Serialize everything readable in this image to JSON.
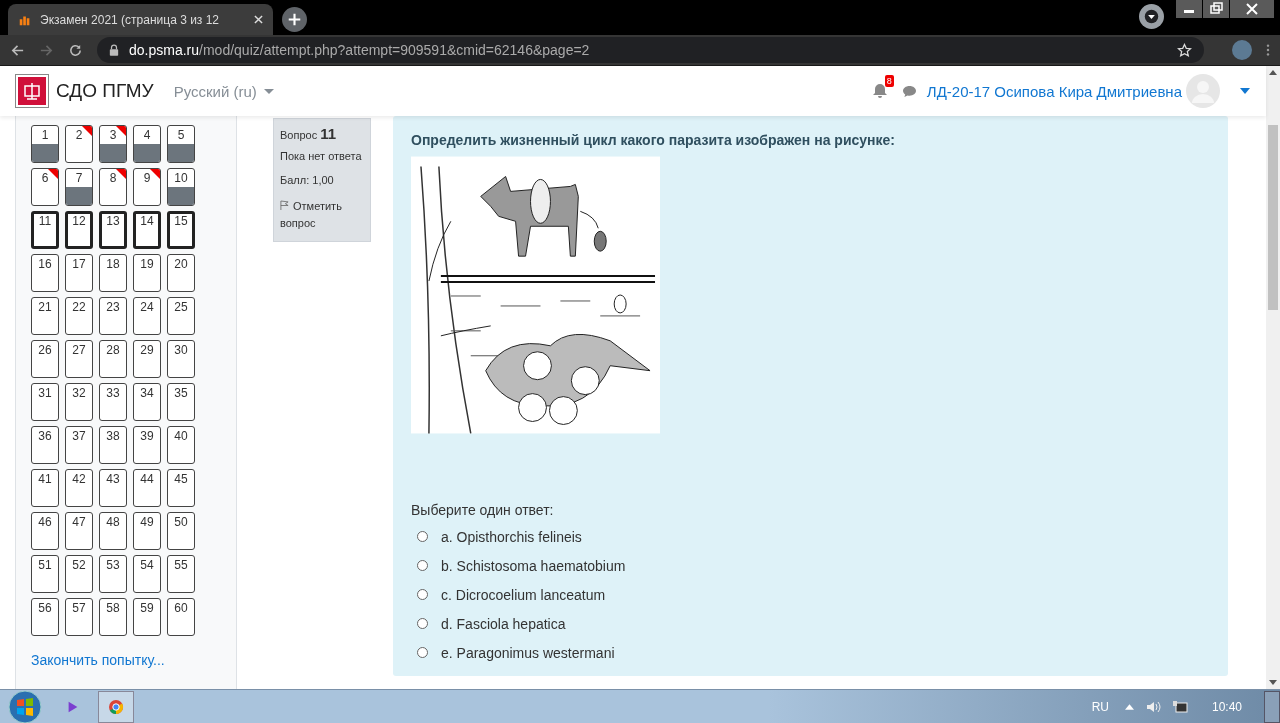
{
  "browser": {
    "tab_title": "Экзамен 2021 (страница 3 из 12",
    "url_host": "do.psma.ru",
    "url_path": "/mod/quiz/attempt.php?attempt=909591&cmid=62146&page=2"
  },
  "header": {
    "site_name": "СДО ПГМУ",
    "language": "Русский (ru)",
    "notification_count": "8",
    "user_name": "ЛД-20-17 Осипова Кира Дмитриевна"
  },
  "quiz_nav": {
    "items": [
      {
        "number": "1",
        "answered": true,
        "flagged": false,
        "current": false
      },
      {
        "number": "2",
        "answered": false,
        "flagged": true,
        "current": false
      },
      {
        "number": "3",
        "answered": true,
        "flagged": true,
        "current": false
      },
      {
        "number": "4",
        "answered": true,
        "flagged": false,
        "current": false
      },
      {
        "number": "5",
        "answered": true,
        "flagged": false,
        "current": false
      },
      {
        "number": "6",
        "answered": false,
        "flagged": true,
        "current": false
      },
      {
        "number": "7",
        "answered": true,
        "flagged": false,
        "current": false
      },
      {
        "number": "8",
        "answered": false,
        "flagged": true,
        "current": false
      },
      {
        "number": "9",
        "answered": false,
        "flagged": true,
        "current": false
      },
      {
        "number": "10",
        "answered": true,
        "flagged": false,
        "current": false
      },
      {
        "number": "11",
        "answered": false,
        "flagged": false,
        "current": true
      },
      {
        "number": "12",
        "answered": false,
        "flagged": false,
        "current": true
      },
      {
        "number": "13",
        "answered": false,
        "flagged": false,
        "current": true
      },
      {
        "number": "14",
        "answered": false,
        "flagged": false,
        "current": true
      },
      {
        "number": "15",
        "answered": false,
        "flagged": false,
        "current": true
      },
      {
        "number": "16",
        "answered": false,
        "flagged": false,
        "current": false
      },
      {
        "number": "17",
        "answered": false,
        "flagged": false,
        "current": false
      },
      {
        "number": "18",
        "answered": false,
        "flagged": false,
        "current": false
      },
      {
        "number": "19",
        "answered": false,
        "flagged": false,
        "current": false
      },
      {
        "number": "20",
        "answered": false,
        "flagged": false,
        "current": false
      },
      {
        "number": "21",
        "answered": false,
        "flagged": false,
        "current": false
      },
      {
        "number": "22",
        "answered": false,
        "flagged": false,
        "current": false
      },
      {
        "number": "23",
        "answered": false,
        "flagged": false,
        "current": false
      },
      {
        "number": "24",
        "answered": false,
        "flagged": false,
        "current": false
      },
      {
        "number": "25",
        "answered": false,
        "flagged": false,
        "current": false
      },
      {
        "number": "26",
        "answered": false,
        "flagged": false,
        "current": false
      },
      {
        "number": "27",
        "answered": false,
        "flagged": false,
        "current": false
      },
      {
        "number": "28",
        "answered": false,
        "flagged": false,
        "current": false
      },
      {
        "number": "29",
        "answered": false,
        "flagged": false,
        "current": false
      },
      {
        "number": "30",
        "answered": false,
        "flagged": false,
        "current": false
      },
      {
        "number": "31",
        "answered": false,
        "flagged": false,
        "current": false
      },
      {
        "number": "32",
        "answered": false,
        "flagged": false,
        "current": false
      },
      {
        "number": "33",
        "answered": false,
        "flagged": false,
        "current": false
      },
      {
        "number": "34",
        "answered": false,
        "flagged": false,
        "current": false
      },
      {
        "number": "35",
        "answered": false,
        "flagged": false,
        "current": false
      },
      {
        "number": "36",
        "answered": false,
        "flagged": false,
        "current": false
      },
      {
        "number": "37",
        "answered": false,
        "flagged": false,
        "current": false
      },
      {
        "number": "38",
        "answered": false,
        "flagged": false,
        "current": false
      },
      {
        "number": "39",
        "answered": false,
        "flagged": false,
        "current": false
      },
      {
        "number": "40",
        "answered": false,
        "flagged": false,
        "current": false
      },
      {
        "number": "41",
        "answered": false,
        "flagged": false,
        "current": false
      },
      {
        "number": "42",
        "answered": false,
        "flagged": false,
        "current": false
      },
      {
        "number": "43",
        "answered": false,
        "flagged": false,
        "current": false
      },
      {
        "number": "44",
        "answered": false,
        "flagged": false,
        "current": false
      },
      {
        "number": "45",
        "answered": false,
        "flagged": false,
        "current": false
      },
      {
        "number": "46",
        "answered": false,
        "flagged": false,
        "current": false
      },
      {
        "number": "47",
        "answered": false,
        "flagged": false,
        "current": false
      },
      {
        "number": "48",
        "answered": false,
        "flagged": false,
        "current": false
      },
      {
        "number": "49",
        "answered": false,
        "flagged": false,
        "current": false
      },
      {
        "number": "50",
        "answered": false,
        "flagged": false,
        "current": false
      },
      {
        "number": "51",
        "answered": false,
        "flagged": false,
        "current": false
      },
      {
        "number": "52",
        "answered": false,
        "flagged": false,
        "current": false
      },
      {
        "number": "53",
        "answered": false,
        "flagged": false,
        "current": false
      },
      {
        "number": "54",
        "answered": false,
        "flagged": false,
        "current": false
      },
      {
        "number": "55",
        "answered": false,
        "flagged": false,
        "current": false
      },
      {
        "number": "56",
        "answered": false,
        "flagged": false,
        "current": false
      },
      {
        "number": "57",
        "answered": false,
        "flagged": false,
        "current": false
      },
      {
        "number": "58",
        "answered": false,
        "flagged": false,
        "current": false
      },
      {
        "number": "59",
        "answered": false,
        "flagged": false,
        "current": false
      },
      {
        "number": "60",
        "answered": false,
        "flagged": false,
        "current": false
      }
    ],
    "finish_link": "Закончить попытку..."
  },
  "question_info": {
    "label": "Вопрос",
    "number": "11",
    "status": "Пока нет ответа",
    "score": "Балл: 1,00",
    "flag_label": "Отметить вопрос"
  },
  "question": {
    "text": "Определить жизненный цикл какого паразита изображен на рисунке:",
    "prompt": "Выберите один ответ:",
    "options": [
      {
        "label": "a. Opisthorchis felineis",
        "selected": false
      },
      {
        "label": "b. Schistosoma haematobium",
        "selected": false
      },
      {
        "label": "c. Dicrocoelium lanceatum",
        "selected": false
      },
      {
        "label": "d. Fasciola hepatica",
        "selected": false
      },
      {
        "label": "e. Paragonimus westermani",
        "selected": false
      }
    ]
  },
  "taskbar": {
    "language": "RU",
    "time": "10:40"
  }
}
